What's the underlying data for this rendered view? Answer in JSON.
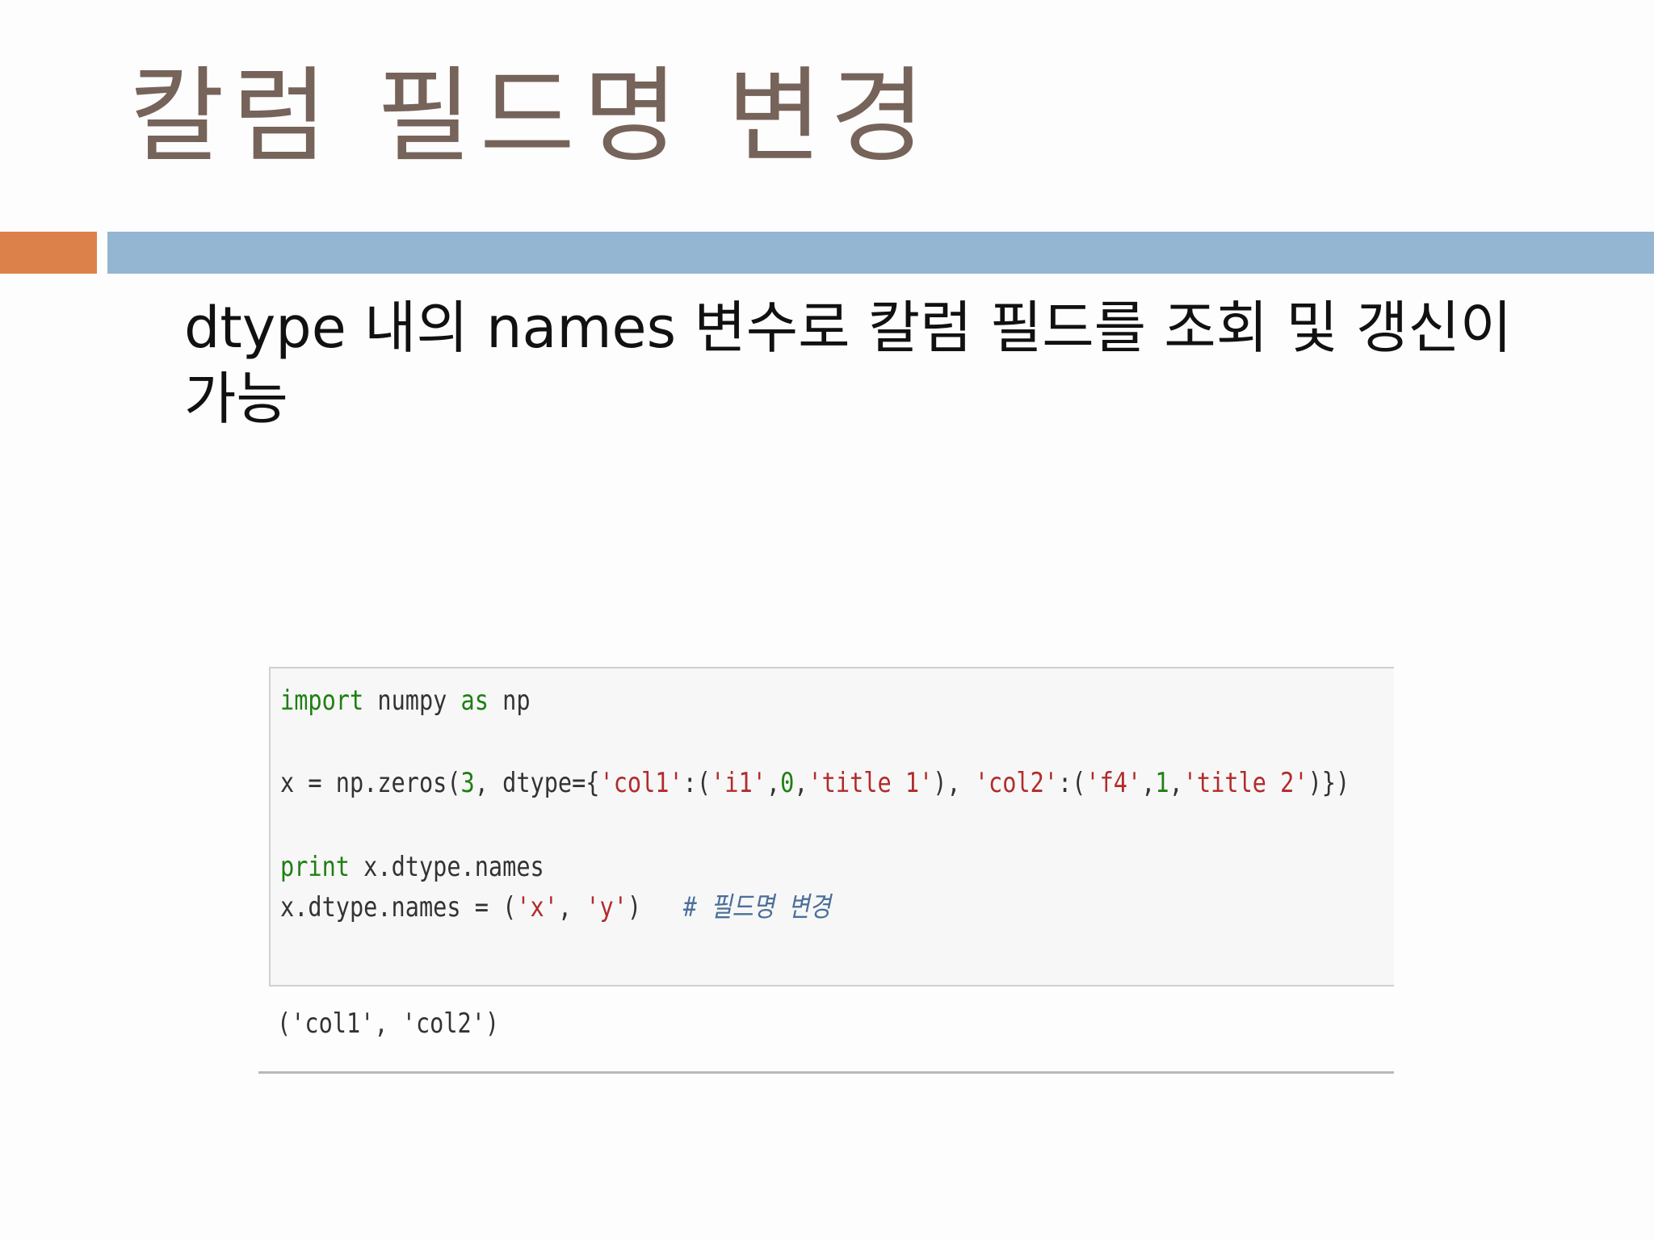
{
  "slide": {
    "title": "칼럼 필드명 변경",
    "body": "dtype 내의 names 변수로 칼럼 필드를 조회 및 갱신이 가능"
  },
  "code": {
    "line1": {
      "kw_import": "import",
      "mod": " numpy ",
      "kw_as": "as",
      "alias": " np"
    },
    "line2": {
      "p1": "x = np.zeros(",
      "n1": "3",
      "p2": ", dtype={",
      "s1": "'col1'",
      "p3": ":(",
      "s2": "'i1'",
      "p4": ",",
      "n2": "0",
      "p5": ",",
      "s3": "'title 1'",
      "p6": "), ",
      "s4": "'col2'",
      "p7": ":(",
      "s5": "'f4'",
      "p8": ",",
      "n3": "1",
      "p9": ",",
      "s6": "'title 2'",
      "p10": ")})"
    },
    "line3": {
      "kw_print": "print",
      "rest": " x.dtype.names"
    },
    "line4": {
      "p1": "x.dtype.names = (",
      "s1": "'x'",
      "p2": ", ",
      "s2": "'y'",
      "p3": ")   ",
      "comment": "# 필드명 변경"
    }
  },
  "output": {
    "text": "('col1', 'col2')"
  },
  "colors": {
    "title": "#76635a",
    "accent_orange": "#dc8149",
    "accent_blue": "#94b6d3",
    "keyword_green": "#1e7f12",
    "string_red": "#b22b2b"
  }
}
